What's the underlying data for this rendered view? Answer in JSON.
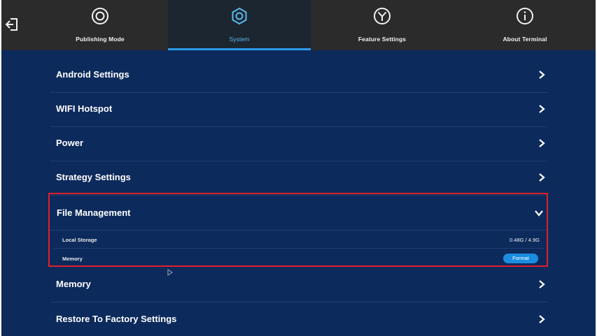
{
  "nav": {
    "tabs": [
      {
        "label": "Publishing Mode",
        "icon": "record-icon"
      },
      {
        "label": "System",
        "icon": "gear-icon",
        "active": true
      },
      {
        "label": "Feature Settings",
        "icon": "y-circle-icon"
      },
      {
        "label": "About Terminal",
        "icon": "info-icon"
      }
    ],
    "back_icon": "exit-icon",
    "active_color": "#2d9be8"
  },
  "settings": {
    "items": [
      {
        "label": "Android Settings"
      },
      {
        "label": "WIFI Hotspot"
      },
      {
        "label": "Power"
      },
      {
        "label": "Strategy Settings"
      }
    ],
    "file_management": {
      "label": "File Management",
      "expanded": true,
      "local_storage": {
        "label": "Local Storage",
        "value": "0.48G / 4.9G"
      },
      "memory": {
        "label": "Memory",
        "button": "Format"
      }
    },
    "after_items": [
      {
        "label": "Memory"
      },
      {
        "label": "Restore To Factory Settings"
      }
    ]
  },
  "colors": {
    "background": "#0c2a5c",
    "topbar": "#2b2b2c",
    "highlight_border": "#e0202a",
    "button": "#1a8de0"
  }
}
